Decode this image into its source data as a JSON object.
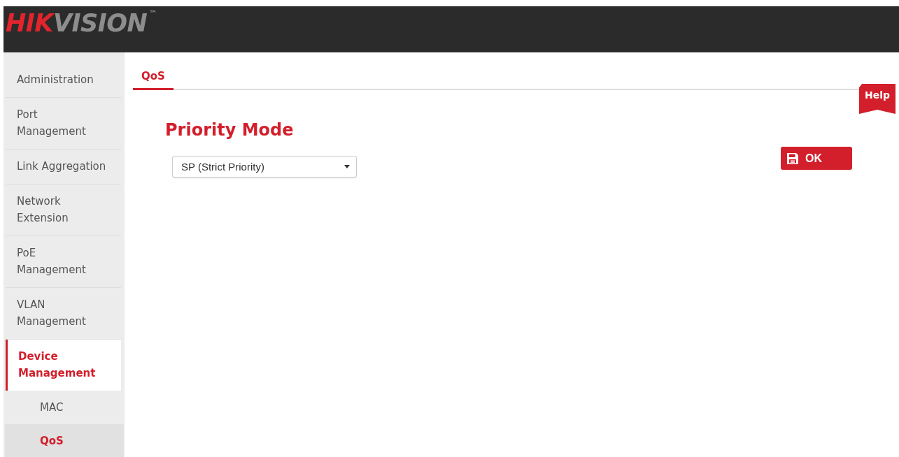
{
  "header": {
    "logo": {
      "first": "HIK",
      "rest": "VISION",
      "trademark": "™"
    }
  },
  "sidebar": {
    "items": [
      {
        "label": "Administration",
        "selected": false
      },
      {
        "label": "Port\nManagement",
        "selected": false
      },
      {
        "label": "Link Aggregation",
        "selected": false
      },
      {
        "label": "Network\nExtension",
        "selected": false
      },
      {
        "label": "PoE\nManagement",
        "selected": false
      },
      {
        "label": "VLAN\nManagement",
        "selected": false
      },
      {
        "label": "Device\nManagement",
        "selected": true,
        "children": [
          {
            "label": "MAC",
            "selected": false
          },
          {
            "label": "QoS",
            "selected": true
          }
        ]
      }
    ]
  },
  "tabs": [
    {
      "label": "QoS",
      "selected": true
    }
  ],
  "help_button": {
    "label": "Help"
  },
  "section": {
    "title": "Priority Mode",
    "priority_mode": {
      "value": "SP (Strict Priority)"
    },
    "ok_button": {
      "label": "OK"
    }
  }
}
